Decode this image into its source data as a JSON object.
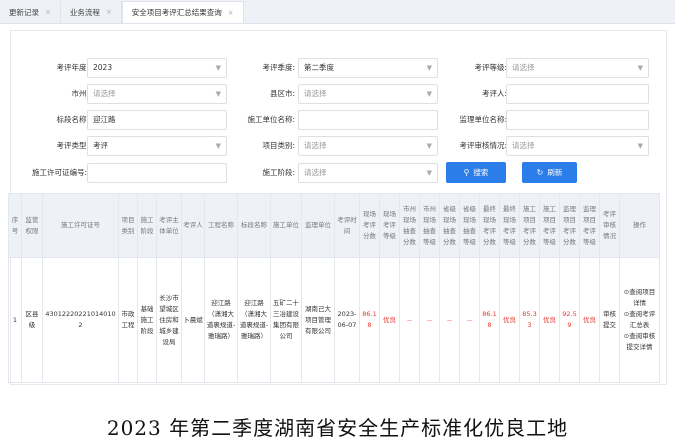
{
  "tabs": [
    {
      "label": "更新记录",
      "active": false
    },
    {
      "label": "业务流程",
      "active": false
    },
    {
      "label": "安全项目考评汇总结果查询",
      "active": true
    }
  ],
  "close_glyph": "×",
  "filters": {
    "year": {
      "label": "考评年度:",
      "value": "2023"
    },
    "season": {
      "label": "考评季度:",
      "value": "第二季度"
    },
    "level": {
      "label": "考评等级:",
      "placeholder": "请选择"
    },
    "city": {
      "label": "市州:",
      "placeholder": "请选择"
    },
    "county": {
      "label": "县区市:",
      "placeholder": "请选择"
    },
    "reviewer": {
      "label": "考评人:",
      "value": ""
    },
    "section": {
      "label": "标段名称:",
      "value": "迎江路"
    },
    "construction_unit": {
      "label": "施工单位名称:",
      "value": ""
    },
    "supervision_unit": {
      "label": "监理单位名称:",
      "value": ""
    },
    "review_type": {
      "label": "考评类型:",
      "value": "考评"
    },
    "project_category": {
      "label": "项目类别:",
      "placeholder": "请选择"
    },
    "audit_status": {
      "label": "考评审核情况:",
      "placeholder": "请选择"
    },
    "permit_no": {
      "label": "施工许可证编号:",
      "value": ""
    },
    "stage": {
      "label": "施工阶段:",
      "placeholder": "请选择"
    }
  },
  "buttons": {
    "search": "搜索",
    "refresh": "刷新"
  },
  "table": {
    "headers": [
      "序号",
      "监管权限",
      "施工许可证号",
      "项目类别",
      "施工阶段",
      "考评主体单位",
      "考评人",
      "工程名称",
      "标段名称",
      "施工单位",
      "监理单位",
      "考评时间",
      "现场考评分数",
      "现场考评等级",
      "市州现场抽查分数",
      "市州现场抽查等级",
      "省级现场抽查分数",
      "省级现场抽查等级",
      "最终现场考评分数",
      "最终现场考评等级",
      "施工项目考评分数",
      "施工项目考评等级",
      "监理项目考评分数",
      "监理项目考评等级",
      "考评审核情况",
      "操作"
    ],
    "row": [
      "1",
      "区县级",
      "430122202210140102",
      "市政工程",
      "基础施工阶段",
      "长沙市望城区住房和城乡建设局",
      "卜晨斌",
      "迎江路（潇湘大道裹规道-雅瑞路）",
      "迎江路（潇湘大道裹规道-雅瑞路）",
      "五矿二十三冶建设集团有限公司",
      "湖南己大项目管理有限公司",
      "2023-06-07",
      "86.18",
      "优良",
      "--",
      "--",
      "--",
      "--",
      "86.18",
      "优良",
      "85.33",
      "优良",
      "92.59",
      "优良",
      "审核提交"
    ],
    "ops": [
      "⊙查阅项目详情",
      "⊙查阅考评汇总表",
      "⊙查阅审核提交详情"
    ]
  },
  "caption": "2023 年第二季度湖南省安全生产标准化优良工地",
  "colors": {
    "accent": "#2b7de9",
    "score_red": "#e23b2e",
    "header_bg": "#eef2f8"
  },
  "icons": {
    "search": "search-icon",
    "refresh": "refresh-icon",
    "dropdown": "chevron-down-icon"
  }
}
